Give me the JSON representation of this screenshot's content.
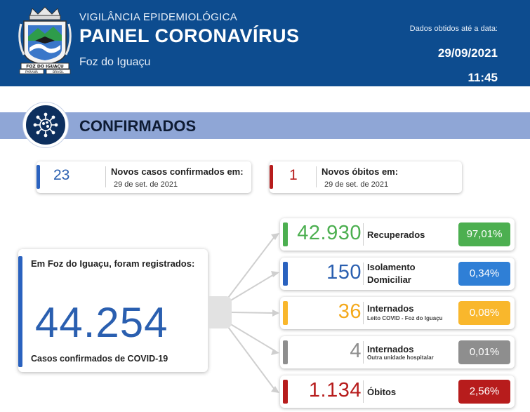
{
  "header": {
    "subtitle": "VIGILÂNCIA EPIDEMIOLÓGICA",
    "title": "PAINEL CORONAVÍRUS",
    "city": "Foz do Iguaçu",
    "data_label": "Dados obtidos até a data:",
    "date": "29/09/2021",
    "time": "11:45",
    "crest_text": "FOZ DO IGUAÇU",
    "crest_left": "PARANÁ",
    "crest_right": "BRASIL"
  },
  "section": {
    "title": "CONFIRMADOS",
    "icon": "virus-icon"
  },
  "new_cases": {
    "value": "23",
    "label": "Novos casos confirmados em:",
    "date": "29 de set. de 2021"
  },
  "new_deaths": {
    "value": "1",
    "label": "Novos óbitos em:",
    "date": "29 de set. de 2021"
  },
  "total": {
    "label": "Em Foz do Iguaçu, foram registrados:",
    "value": "44.254",
    "footer": "Casos confirmados de COVID-19"
  },
  "breakdown": [
    {
      "value": "42.930",
      "label": "Recuperados",
      "sub": "",
      "pct": "97,01%",
      "color": "#4caf50",
      "bar": "#4caf50",
      "num_color": "#4caf50"
    },
    {
      "value": "150",
      "label": "Isolamento Domicilar",
      "label1": "Isolamento",
      "label2": "Domiciliar",
      "sub": "",
      "pct": "0,34%",
      "color": "#2f7fd6",
      "bar": "#2a62bf",
      "num_color": "#2a5fb0"
    },
    {
      "value": "36",
      "label": "Internados",
      "sub": "Leito COVID - Foz do Iguaçu",
      "pct": "0,08%",
      "color": "#f9b72c",
      "bar": "#f9b72c",
      "num_color": "#f4a91b"
    },
    {
      "value": "4",
      "label": "Internados",
      "sub": "Outra unidade hospitalar",
      "pct": "0,01%",
      "color": "#8e8e8e",
      "bar": "#8e8e8e",
      "num_color": "#8e8e8e"
    },
    {
      "value": "1.134",
      "label": "Óbitos",
      "sub": "",
      "pct": "2,56%",
      "color": "#b71c1c",
      "bar": "#b71c1c",
      "num_color": "#b71c1c"
    }
  ],
  "colors": {
    "header_bg": "#0d4c8f",
    "band_bg": "#8fa6d6",
    "cases_bar": "#2a62bf",
    "deaths_bar": "#b71c1c"
  }
}
